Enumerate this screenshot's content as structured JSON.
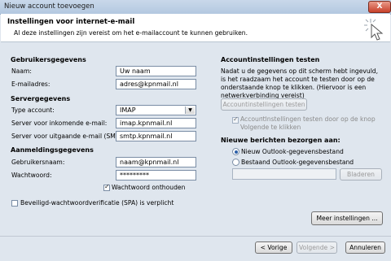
{
  "window": {
    "title": "Nieuw account toevoegen",
    "close_glyph": "X"
  },
  "header": {
    "title": "Instellingen voor internet-e-mail",
    "subtitle": "Al deze instellingen zijn vereist om het e-mailaccount te kunnen gebruiken."
  },
  "left": {
    "user_section": "Gebruikersgegevens",
    "name_label": "Naam:",
    "name_value": "Uw naam",
    "email_label": "E-mailadres:",
    "email_value": "adres@kpnmail.nl",
    "server_section": "Servergegevens",
    "account_type_label": "Type account:",
    "account_type_value": "IMAP",
    "incoming_label": "Server voor inkomende e-mail:",
    "incoming_value": "imap.kpnmail.nl",
    "outgoing_label": "Server voor uitgaande e-mail (SMTP):",
    "outgoing_value": "smtp.kpnmail.nl",
    "login_section": "Aanmeldingsgegevens",
    "username_label": "Gebruikersnaam:",
    "username_value": "naam@kpnmail.nl",
    "password_label": "Wachtwoord:",
    "password_value": "*********",
    "remember_label": "Wachtwoord onthouden",
    "remember_checked": true,
    "spa_label": "Beveiligd-wachtwoordverificatie (SPA) is verplicht",
    "spa_checked": false
  },
  "right": {
    "test_section": "Accountinstellingen testen",
    "test_description": "Nadat u de gegevens op dit scherm hebt ingevuld, is het raadzaam het account te testen door op de onderstaande knop te klikken. (Hiervoor is een netwerkverbinding vereist)",
    "test_button": "Accountinstellingen testen ...",
    "auto_test_label": "Accountinstellingen testen door op de knop Volgende te klikken",
    "deliver_section": "Nieuwe berichten bezorgen aan:",
    "option_new": "Nieuw Outlook-gegevensbestand",
    "option_existing": "Bestaand Outlook-gegevensbestand",
    "browse_button": "Bladeren",
    "more_settings_button": "Meer instellingen ..."
  },
  "footer": {
    "back_button": "< Vorige",
    "next_button": "Volgende >",
    "cancel_button": "Annuleren"
  }
}
